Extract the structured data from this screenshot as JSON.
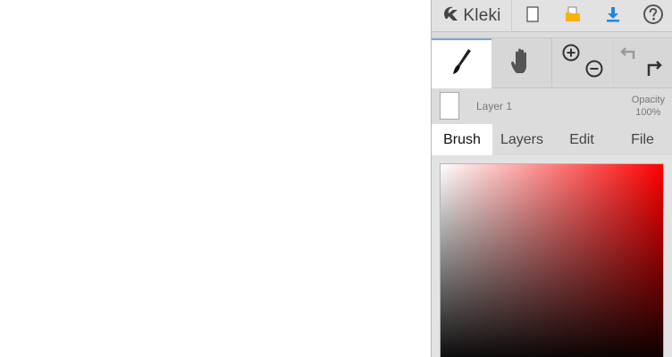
{
  "app": {
    "logo_text": "Kleki"
  },
  "topbar": {
    "buttons": [
      {
        "name": "new-image",
        "icon": "new-page-icon"
      },
      {
        "name": "open",
        "icon": "open-folder-icon"
      },
      {
        "name": "save",
        "icon": "download-icon"
      },
      {
        "name": "help",
        "icon": "help-icon"
      }
    ]
  },
  "tools": {
    "active": "brush",
    "items": [
      {
        "name": "brush",
        "icon": "brush-icon"
      },
      {
        "name": "hand",
        "icon": "hand-icon"
      },
      {
        "name": "zoom",
        "icon": "zoom-in-out-icon"
      },
      {
        "name": "undo-redo",
        "icon": "undo-redo-icon"
      }
    ]
  },
  "layer": {
    "name": "Layer 1",
    "opacity_label": "Opacity",
    "opacity_value": "100%"
  },
  "tabs": {
    "active": "Brush",
    "items": [
      "Brush",
      "Layers",
      "Edit",
      "File"
    ]
  },
  "color_picker": {
    "hue_color": "#ff0000"
  },
  "colors": {
    "sidebar_bg": "#dcdcdc",
    "accent_blue": "#1e88e5",
    "folder_yellow": "#f5b400",
    "icon_gray": "#555555"
  }
}
